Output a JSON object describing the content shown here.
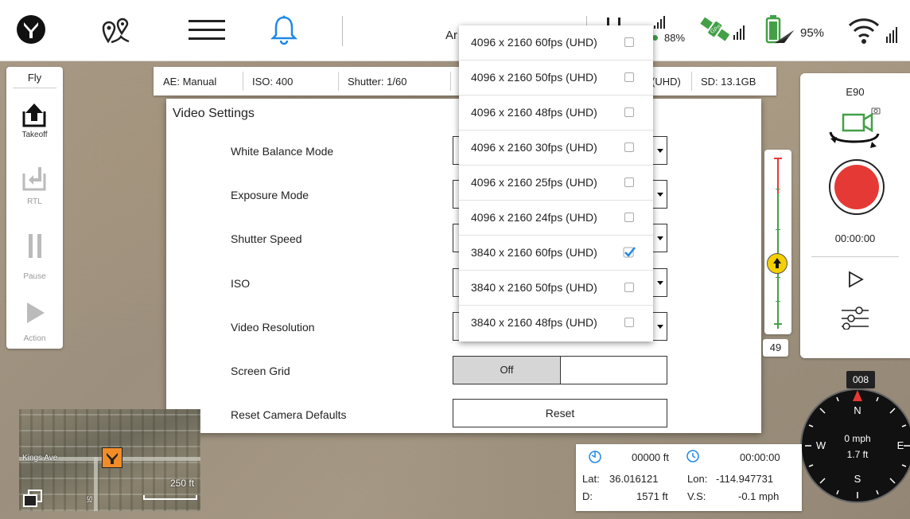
{
  "topbar": {
    "mode_partial": "Ar",
    "battery1_percent": "88%",
    "battery2_percent": "95%",
    "gps_badge": "GPS"
  },
  "left_panel": {
    "header": "Fly",
    "takeoff_label": "Takeoff",
    "rtl_label": "RTL",
    "pause_label": "Pause",
    "action_label": "Action"
  },
  "status_bar": {
    "ae": "AE:  Manual",
    "iso": "ISO:  400",
    "shutter": "Shutter:  1/60",
    "uhd_partial": "(UHD)",
    "sd": "SD:  13.1GB"
  },
  "dialog": {
    "title": "Video Settings",
    "rows": [
      {
        "label": "White Balance Mode"
      },
      {
        "label": "Exposure Mode"
      },
      {
        "label": "Shutter Speed"
      },
      {
        "label": "ISO"
      },
      {
        "label": "Video Resolution"
      }
    ],
    "screen_grid_label": "Screen Grid",
    "screen_grid_off": "Off",
    "reset_label": "Reset Camera Defaults",
    "reset_button": "Reset"
  },
  "resolution_options": [
    {
      "label": "4096 x 2160 60fps (UHD)",
      "checked": false
    },
    {
      "label": "4096 x 2160 50fps (UHD)",
      "checked": false
    },
    {
      "label": "4096 x 2160 48fps (UHD)",
      "checked": false
    },
    {
      "label": "4096 x 2160 30fps (UHD)",
      "checked": false
    },
    {
      "label": "4096 x 2160 25fps (UHD)",
      "checked": false
    },
    {
      "label": "4096 x 2160 24fps (UHD)",
      "checked": false
    },
    {
      "label": "3840 x 2160 60fps (UHD)",
      "checked": true
    },
    {
      "label": "3840 x 2160 50fps (UHD)",
      "checked": false
    },
    {
      "label": "3840 x 2160 48fps (UHD)",
      "checked": false
    }
  ],
  "right_panel": {
    "camera_model": "E90",
    "record_timer": "00:00:00"
  },
  "altitude": {
    "value": "49"
  },
  "compass": {
    "heading": "008",
    "n": "N",
    "s": "S",
    "e": "E",
    "w": "W",
    "speed": "0 mph",
    "altitude": "1.7 ft"
  },
  "telemetry": {
    "distance_top": "00000 ft",
    "time": "00:00:00",
    "lat_label": "Lat:",
    "lat": "36.016121",
    "lon_label": "Lon:",
    "lon": "-114.947731",
    "d_label": "D:",
    "d": "1571 ft",
    "vs_label": "V.S:",
    "vs": "-0.1 mph"
  },
  "minimap": {
    "street": "Kings Ave",
    "scale": "250 ft",
    "street2": "St"
  },
  "colors": {
    "accent_blue": "#1e88e5",
    "record_red": "#e53935",
    "green": "#43a047",
    "altitude_marker": "#f5d000",
    "drone_orange": "#f28c28"
  }
}
